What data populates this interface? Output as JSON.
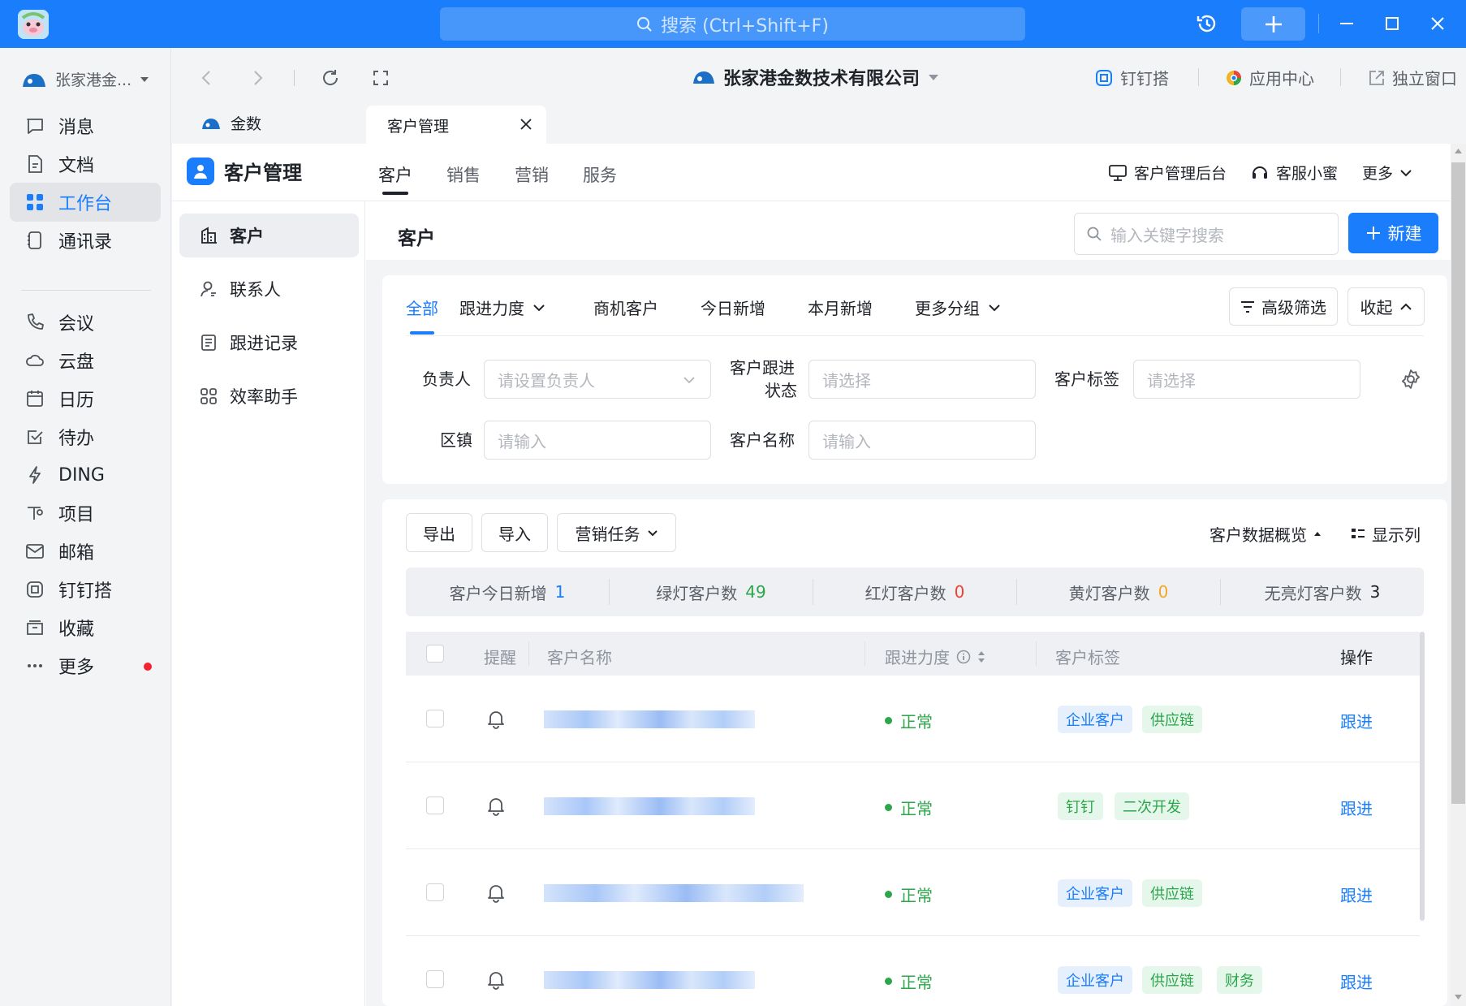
{
  "titlebar": {
    "search_placeholder": "搜索 (Ctrl+Shift+F)",
    "accent": "#1a7dfb"
  },
  "org": {
    "name": "张家港金..."
  },
  "nav": {
    "items": [
      {
        "label": "消息",
        "icon": "message-icon"
      },
      {
        "label": "文档",
        "icon": "document-icon"
      },
      {
        "label": "工作台",
        "icon": "workbench-icon",
        "active": true
      },
      {
        "label": "通讯录",
        "icon": "contacts-icon"
      },
      {
        "label": "会议",
        "icon": "meeting-icon"
      },
      {
        "label": "云盘",
        "icon": "cloud-drive-icon"
      },
      {
        "label": "日历",
        "icon": "calendar-icon"
      },
      {
        "label": "待办",
        "icon": "todo-icon"
      },
      {
        "label": "DING",
        "icon": "ding-icon"
      },
      {
        "label": "项目",
        "icon": "project-icon"
      },
      {
        "label": "邮箱",
        "icon": "mail-icon"
      },
      {
        "label": "钉钉搭",
        "icon": "dingda-icon"
      },
      {
        "label": "收藏",
        "icon": "favorites-icon"
      },
      {
        "label": "更多",
        "icon": "more-icon"
      }
    ]
  },
  "header": {
    "company": "张家港金数技术有限公司",
    "links": {
      "dingda": "钉钉搭",
      "app_center": "应用中心",
      "standalone": "独立窗口"
    }
  },
  "tabs": {
    "home": "金数",
    "current": "客户管理"
  },
  "module": {
    "title": "客户管理",
    "tabs": [
      "客户",
      "销售",
      "营销",
      "服务"
    ],
    "admin": "客户管理后台",
    "assistant": "客服小蜜",
    "more": "更多"
  },
  "side_menu": [
    "客户",
    "联系人",
    "跟进记录",
    "效率助手"
  ],
  "page": {
    "title": "客户",
    "search_placeholder": "输入关键字搜索",
    "new_label": "新建"
  },
  "filter_tabs": [
    "全部",
    "跟进力度",
    "商机客户",
    "今日新增",
    "本月新增",
    "更多分组"
  ],
  "filter_buttons": {
    "advanced": "高级筛选",
    "collapse": "收起"
  },
  "filters": {
    "owner_label": "负责人",
    "owner_placeholder": "请设置负责人",
    "status_label_1": "客户跟进",
    "status_label_2": "状态",
    "status_placeholder": "请选择",
    "tag_label": "客户标签",
    "tag_placeholder": "请选择",
    "town_label": "区镇",
    "town_placeholder": "请输入",
    "name_label": "客户名称",
    "name_placeholder": "请输入"
  },
  "toolbar": {
    "export": "导出",
    "import": "导入",
    "marketing": "营销任务",
    "overview": "客户数据概览",
    "columns": "显示列"
  },
  "stats": [
    {
      "label": "客户今日新增",
      "value": "1",
      "color": "#1a7dfb"
    },
    {
      "label": "绿灯客户数",
      "value": "49",
      "color": "#2ca64b"
    },
    {
      "label": "红灯客户数",
      "value": "0",
      "color": "#f04134"
    },
    {
      "label": "黄灯客户数",
      "value": "0",
      "color": "#f5a623"
    },
    {
      "label": "无亮灯客户数",
      "value": "3",
      "color": "#1f2329"
    }
  ],
  "table": {
    "headers": {
      "remind": "提醒",
      "name": "客户名称",
      "level": "跟进力度",
      "tags": "客户标签",
      "action": "操作"
    },
    "rows": [
      {
        "status": "正常",
        "tags": [
          {
            "text": "企业客户",
            "style": "blue"
          },
          {
            "text": "供应链",
            "style": "green"
          }
        ],
        "action": "跟进"
      },
      {
        "status": "正常",
        "tags": [
          {
            "text": "钉钉",
            "style": "green"
          },
          {
            "text": "二次开发",
            "style": "green"
          }
        ],
        "action": "跟进"
      },
      {
        "status": "正常",
        "tags": [
          {
            "text": "企业客户",
            "style": "blue"
          },
          {
            "text": "供应链",
            "style": "green"
          }
        ],
        "action": "跟进"
      },
      {
        "status": "正常",
        "tags": [
          {
            "text": "企业客户",
            "style": "blue"
          },
          {
            "text": "供应链",
            "style": "green"
          },
          {
            "text": "财务",
            "style": "green"
          }
        ],
        "action": "跟进"
      }
    ]
  }
}
